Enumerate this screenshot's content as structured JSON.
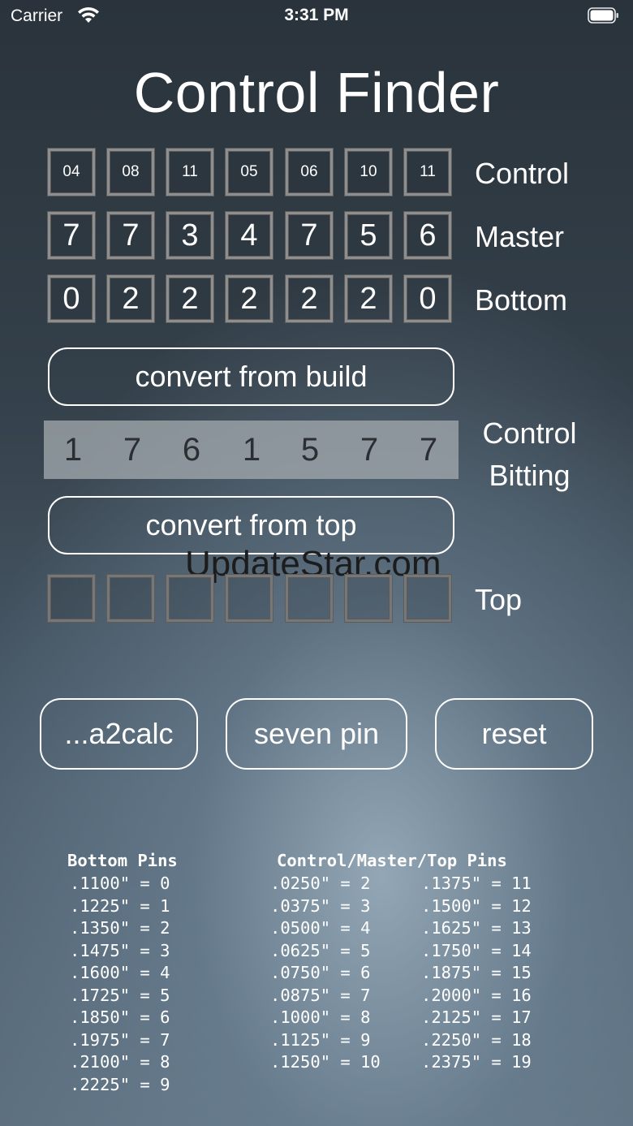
{
  "status_bar": {
    "carrier": "Carrier",
    "time": "3:31 PM"
  },
  "title": "Control Finder",
  "rows": {
    "control": {
      "label": "Control",
      "values": [
        "04",
        "08",
        "11",
        "05",
        "06",
        "10",
        "11"
      ]
    },
    "master": {
      "label": "Master",
      "values": [
        "7",
        "7",
        "3",
        "4",
        "7",
        "5",
        "6"
      ]
    },
    "bottom": {
      "label": "Bottom",
      "values": [
        "0",
        "2",
        "2",
        "2",
        "2",
        "2",
        "0"
      ]
    },
    "top": {
      "label": "Top",
      "values": [
        "",
        "",
        "",
        "",
        "",
        "",
        ""
      ]
    }
  },
  "buttons": {
    "convert_build": "convert from build",
    "convert_top": "convert from top",
    "a2calc": "...a2calc",
    "seven_pin": "seven pin",
    "reset": "reset"
  },
  "control_bitting": {
    "label_line1": "Control",
    "label_line2": "Bitting",
    "values": [
      "1",
      "7",
      "6",
      "1",
      "5",
      "7",
      "7"
    ]
  },
  "watermark": "UpdateStar.com",
  "reference": {
    "bottom_header": "Bottom Pins",
    "bottom_pins": [
      ".1100\" = 0",
      ".1225\" = 1",
      ".1350\" = 2",
      ".1475\" = 3",
      ".1600\" = 4",
      ".1725\" = 5",
      ".1850\" = 6",
      ".1975\" = 7",
      ".2100\" = 8",
      ".2225\" = 9"
    ],
    "cmt_header": "Control/Master/Top Pins",
    "cmt_col1": [
      ".0250\" = 2",
      ".0375\" = 3",
      ".0500\" = 4",
      ".0625\" = 5",
      ".0750\" = 6",
      ".0875\" = 7",
      ".1000\" = 8",
      ".1125\" = 9",
      ".1250\" = 10"
    ],
    "cmt_col2": [
      ".1375\" = 11",
      ".1500\" = 12",
      ".1625\" = 13",
      ".1750\" = 14",
      ".1875\" = 15",
      ".2000\" = 16",
      ".2125\" = 17",
      ".2250\" = 18",
      ".2375\" = 19"
    ]
  }
}
